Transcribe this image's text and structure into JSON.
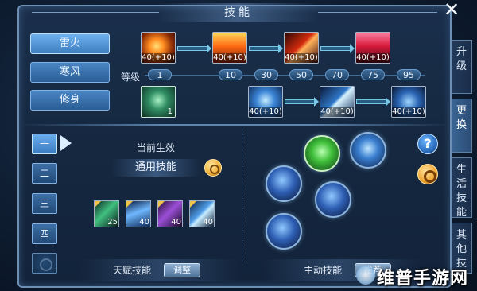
{
  "window": {
    "title": "技能"
  },
  "categories": [
    {
      "label": "雷火",
      "active": true
    },
    {
      "label": "寒风",
      "active": false
    },
    {
      "label": "修身",
      "active": false
    }
  ],
  "skill_row_fire": {
    "icons": [
      "fire-burst-icon",
      "fire-column-icon",
      "fire-slash-icon",
      "fire-rain-icon"
    ],
    "levels": [
      "40(+10)",
      "40(+10)",
      "40(+10)",
      "40(+10)"
    ]
  },
  "level_track": {
    "label": "等级",
    "values": [
      "1",
      "10",
      "30",
      "50",
      "70",
      "75",
      "95"
    ]
  },
  "skill_row_thunder": {
    "icons": [
      "fist-icon",
      "lightning-icon",
      "lightning-strike-icon",
      "lightning-storm-icon"
    ],
    "levels": [
      "1",
      "40(+10)",
      "40(+10)",
      "40(+10)"
    ]
  },
  "side_tabs": [
    {
      "label": "升级",
      "active": false
    },
    {
      "label": "更换",
      "active": true
    },
    {
      "label": "生活技能",
      "active": false
    },
    {
      "label": "其他技能",
      "active": false
    }
  ],
  "pages": [
    "一",
    "二",
    "三",
    "四"
  ],
  "current_effect": {
    "label": "当前生效",
    "value": "通用技能"
  },
  "talents": [
    {
      "icon": "poison-icon",
      "level": "25"
    },
    {
      "icon": "ice-shards-icon",
      "level": "40"
    },
    {
      "icon": "shadow-icon",
      "level": "40"
    },
    {
      "icon": "thunder-icon",
      "level": "40"
    }
  ],
  "active_skill_orbs": [
    "running-figure-icon",
    "summon-figure-icon",
    "arrows-icon",
    "lightning-orb-icon",
    "thunder-palm-icon"
  ],
  "bottom": {
    "talent_label": "天赋技能",
    "talent_button": "调整",
    "active_label": "主动技能",
    "active_button": "推荐"
  },
  "watermark": "维普手游网",
  "colors": {
    "accent": "#3d7fc0",
    "gold": "#f2b33a",
    "frame": "#6d8fb4"
  }
}
